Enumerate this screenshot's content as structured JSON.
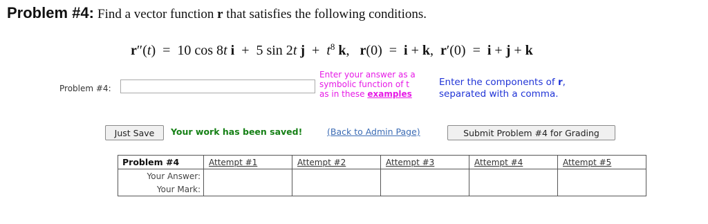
{
  "problem": {
    "title": "Problem #4:",
    "instruction_prefix": "Find a vector function",
    "instruction_var": "r",
    "instruction_suffix": "that satisfies the following conditions."
  },
  "equation": {
    "lhs": "r″(t)",
    "rhs": "= 10 cos 8t i + 5 sin 2t j + t⁸ k,",
    "ic1": "r(0) = i + k,",
    "ic2": "r′(0) = i + j + k"
  },
  "answer": {
    "label": "Problem #4:",
    "value": "",
    "placeholder": ""
  },
  "hint": {
    "line1": "Enter your answer as a",
    "line2": "symbolic function of t",
    "line3_prefix": "as in these",
    "link": "examples"
  },
  "components_note": {
    "prefix": "Enter the components of",
    "var": "r",
    "suffix": ",",
    "line2": "separated with a comma."
  },
  "toolbar": {
    "just_save": "Just Save",
    "saved_msg": "Your work has been saved!",
    "back_link": "(Back to Admin Page)",
    "submit": "Submit Problem #4 for Grading"
  },
  "attempts_table": {
    "row_header": "Problem #4",
    "answer_label": "Your Answer:",
    "mark_label": "Your Mark:",
    "attempts": [
      "Attempt #1",
      "Attempt #2",
      "Attempt #3",
      "Attempt #4",
      "Attempt #5"
    ]
  },
  "colors": {
    "hint": "#e619e6",
    "components_note": "#1f33d6",
    "saved": "#158015",
    "link": "#3b6bb4"
  }
}
